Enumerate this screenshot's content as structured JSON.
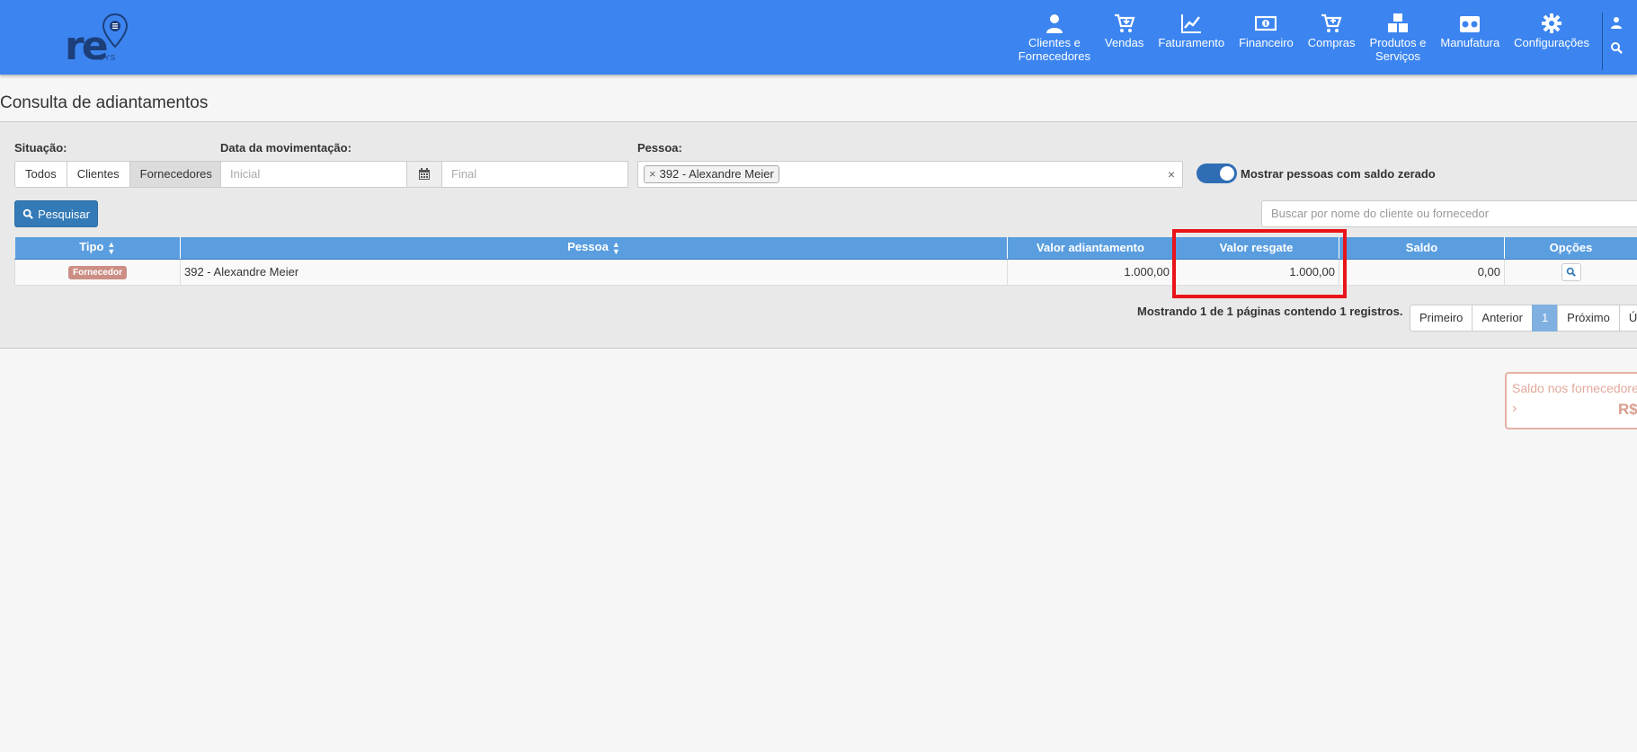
{
  "header": {
    "logo_text": "re",
    "logo_sub": "SYS",
    "nav": [
      {
        "label": "Clientes e\nFornecedores",
        "icon": "user-icon"
      },
      {
        "label": "Vendas",
        "icon": "cart-icon"
      },
      {
        "label": "Faturamento",
        "icon": "chart-line-icon"
      },
      {
        "label": "Financeiro",
        "icon": "money-icon"
      },
      {
        "label": "Compras",
        "icon": "cart-plus-icon"
      },
      {
        "label": "Produtos e\nServiços",
        "icon": "cubes-icon"
      },
      {
        "label": "Manufatura",
        "icon": "industry-icon"
      },
      {
        "label": "Configurações",
        "icon": "gear-icon"
      }
    ]
  },
  "page": {
    "title": "Consulta de adiantamentos"
  },
  "filters": {
    "situacao_label": "Situação:",
    "situacao_options": [
      "Todos",
      "Clientes",
      "Fornecedores"
    ],
    "situacao_selected": "Fornecedores",
    "data_label": "Data da movimentação:",
    "data_inicial_placeholder": "Inicial",
    "data_final_placeholder": "Final",
    "pessoa_label": "Pessoa:",
    "pessoa_selected": "392 - Alexandre Meier",
    "toggle_label": "Mostrar pessoas com saldo zerado",
    "toggle_on": true,
    "search_button": "Pesquisar",
    "search_placeholder": "Buscar por nome do cliente ou fornecedor"
  },
  "table": {
    "columns": [
      "Tipo",
      "Pessoa",
      "Valor adiantamento",
      "Valor resgate",
      "Saldo",
      "Opções"
    ],
    "rows": [
      {
        "tipo": "Fornecedor",
        "pessoa": "392 - Alexandre Meier",
        "valor_adiantamento": "1.000,00",
        "valor_resgate": "1.000,00",
        "saldo": "0,00"
      }
    ]
  },
  "pagination": {
    "info": "Mostrando 1 de 1 páginas contendo 1 registros.",
    "first": "Primeiro",
    "prev": "Anterior",
    "current": "1",
    "next": "Próximo",
    "last": "Último"
  },
  "card": {
    "title": "Saldo nos fornecedores",
    "value": "R$"
  },
  "colors": {
    "topbar": "#3c85f0",
    "table_header": "#5a9ee0",
    "primary_button": "#337ab7",
    "badge": "#cc8e84",
    "highlight": "#e8141a"
  }
}
